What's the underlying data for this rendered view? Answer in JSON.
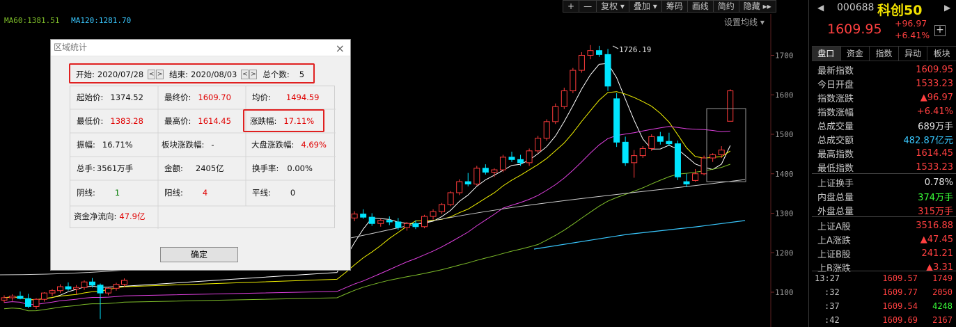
{
  "toolbar": {
    "buttons": [
      "+",
      "—",
      "复权 ▾",
      "叠加 ▾",
      "筹码",
      "画线",
      "简约",
      "隐藏 ▸▸"
    ]
  },
  "ma_legend": {
    "items": [
      {
        "label": "MA60:1381.51",
        "color": "#7fbf2a"
      },
      {
        "label": "MA120:1281.70",
        "color": "#39c8ff"
      }
    ],
    "settings_label": "设置均线 ▾"
  },
  "chart_data": {
    "type": "candlestick",
    "price_axis": {
      "ticks": [
        1700,
        1600,
        1500,
        1400,
        1300,
        1200,
        1100
      ]
    },
    "high_annotation": "1726.19",
    "ohlc": [
      [
        1080,
        1092,
        1074,
        1086
      ],
      [
        1086,
        1095,
        1078,
        1090
      ],
      [
        1090,
        1102,
        1082,
        1084
      ],
      [
        1084,
        1096,
        1060,
        1064
      ],
      [
        1064,
        1085,
        1058,
        1082
      ],
      [
        1082,
        1100,
        1076,
        1098
      ],
      [
        1098,
        1108,
        1090,
        1104
      ],
      [
        1104,
        1120,
        1098,
        1114
      ],
      [
        1114,
        1125,
        1104,
        1108
      ],
      [
        1108,
        1118,
        1095,
        1112
      ],
      [
        1112,
        1130,
        1106,
        1126
      ],
      [
        1126,
        1136,
        1112,
        1118
      ],
      [
        1118,
        1122,
        1032,
        1098
      ],
      [
        1098,
        1112,
        1092,
        1110
      ],
      [
        1110,
        1124,
        1104,
        1120
      ],
      [
        1120,
        1135,
        1114,
        1130
      ],
      [
        1286,
        1296,
        1276,
        1292
      ],
      [
        1292,
        1302,
        1283,
        1288
      ],
      [
        1288,
        1305,
        1280,
        1298
      ],
      [
        1298,
        1310,
        1286,
        1290
      ],
      [
        1290,
        1300,
        1268,
        1274
      ],
      [
        1274,
        1286,
        1266,
        1282
      ],
      [
        1282,
        1292,
        1270,
        1278
      ],
      [
        1278,
        1288,
        1258,
        1264
      ],
      [
        1264,
        1278,
        1256,
        1274
      ],
      [
        1274,
        1282,
        1260,
        1266
      ],
      [
        1266,
        1296,
        1262,
        1292
      ],
      [
        1292,
        1310,
        1284,
        1304
      ],
      [
        1304,
        1326,
        1298,
        1322
      ],
      [
        1322,
        1356,
        1318,
        1352
      ],
      [
        1352,
        1386,
        1346,
        1380
      ],
      [
        1380,
        1402,
        1368,
        1374
      ],
      [
        1374,
        1420,
        1370,
        1414
      ],
      [
        1414,
        1424,
        1398,
        1404
      ],
      [
        1404,
        1414,
        1392,
        1410
      ],
      [
        1410,
        1448,
        1404,
        1442
      ],
      [
        1442,
        1456,
        1430,
        1436
      ],
      [
        1436,
        1448,
        1420,
        1428
      ],
      [
        1428,
        1464,
        1420,
        1458
      ],
      [
        1458,
        1496,
        1452,
        1490
      ],
      [
        1490,
        1538,
        1484,
        1532
      ],
      [
        1532,
        1578,
        1526,
        1570
      ],
      [
        1570,
        1618,
        1564,
        1610
      ],
      [
        1610,
        1668,
        1604,
        1662
      ],
      [
        1662,
        1708,
        1656,
        1700
      ],
      [
        1700,
        1726,
        1690,
        1712
      ],
      [
        1712,
        1724,
        1696,
        1702
      ],
      [
        1702,
        1716,
        1610,
        1622
      ],
      [
        1590,
        1604,
        1468,
        1480
      ],
      [
        1480,
        1494,
        1420,
        1428
      ],
      [
        1428,
        1460,
        1390,
        1446
      ],
      [
        1446,
        1470,
        1440,
        1464
      ],
      [
        1464,
        1500,
        1458,
        1494
      ],
      [
        1494,
        1506,
        1474,
        1482
      ],
      [
        1482,
        1504,
        1470,
        1476
      ],
      [
        1476,
        1484,
        1384,
        1392
      ],
      [
        1380,
        1400,
        1366,
        1374
      ],
      [
        1383,
        1412,
        1380,
        1400
      ],
      [
        1400,
        1446,
        1396,
        1440
      ],
      [
        1440,
        1452,
        1430,
        1448
      ],
      [
        1448,
        1470,
        1440,
        1460
      ],
      [
        1533,
        1614,
        1533,
        1610
      ]
    ],
    "ma_lines": [
      {
        "name": "MA5",
        "color": "#ffffff"
      },
      {
        "name": "MA10",
        "color": "#f0f000"
      },
      {
        "name": "MA20",
        "color": "#e040e0"
      },
      {
        "name": "MA60",
        "color": "#7fbf2a",
        "value": 1381.51
      },
      {
        "name": "MA120",
        "color": "#39c8ff",
        "value": 1281.7
      },
      {
        "name": "MA250",
        "color": "#cfcfcf"
      }
    ],
    "colors": {
      "up": "#ff3b3b",
      "down": "#00e5ff"
    }
  },
  "dialog": {
    "title": "区域统计",
    "close_icon": "×",
    "start_label": "开始:",
    "start_value": "2020/07/28",
    "end_label": "结束:",
    "end_value": "2020/08/03",
    "count_label": "总个数:",
    "count_value": "5",
    "cells": {
      "open": {
        "label": "起始价:",
        "value": "1374.52"
      },
      "close": {
        "label": "最终价:",
        "value": "1609.70"
      },
      "avg": {
        "label": "均价:",
        "value": "1494.59"
      },
      "low": {
        "label": "最低价:",
        "value": "1383.28"
      },
      "high": {
        "label": "最高价:",
        "value": "1614.45"
      },
      "change": {
        "label": "涨跌幅:",
        "value": "17.11%"
      },
      "amplitude": {
        "label": "振幅:",
        "value": "16.71%"
      },
      "sector": {
        "label": "板块涨跌幅:",
        "value": "-"
      },
      "market": {
        "label": "大盘涨跌幅:",
        "value": "4.69%"
      },
      "volume": {
        "label": "总手:",
        "value": "3561万手"
      },
      "amount": {
        "label": "金额:",
        "value": "2405亿"
      },
      "turnover": {
        "label": "换手率:",
        "value": "0.00%"
      },
      "yin": {
        "label": "阴线:",
        "value": "1"
      },
      "yang": {
        "label": "阳线:",
        "value": "4"
      },
      "flat": {
        "label": "平线:",
        "value": "0"
      },
      "netflow": {
        "label": "资金净流向:",
        "value": "47.9亿"
      }
    },
    "ok_label": "确定"
  },
  "right_panel": {
    "code": "000688",
    "name": "科创50",
    "price": "1609.95",
    "change": "+96.97",
    "change_pct": "+6.41%",
    "add_icon": "+",
    "tabs": [
      "盘口",
      "资金",
      "指数",
      "异动",
      "板块"
    ],
    "rows": [
      {
        "label": "最新指数",
        "value": "1609.95",
        "color": "#ff4040"
      },
      {
        "label": "今日开盘",
        "value": "1533.23",
        "color": "#ff4040"
      },
      {
        "label": "指数涨跌",
        "value": "▲96.97",
        "color": "#ff4040"
      },
      {
        "label": "指数涨幅",
        "value": "+6.41%",
        "color": "#ff4040"
      },
      {
        "label": "总成交量",
        "value": "689万手",
        "color": "#e6e6e6"
      },
      {
        "label": "总成交额",
        "value": "482.87亿元",
        "color": "#39c8ff"
      },
      {
        "label": "最高指数",
        "value": "1614.45",
        "color": "#ff4040"
      },
      {
        "label": "最低指数",
        "value": "1533.23",
        "color": "#ff4040"
      },
      {
        "label": "上证换手",
        "value": "0.78%",
        "color": "#e6e6e6"
      },
      {
        "label": "内盘总量",
        "value": "374万手",
        "color": "#39ff39"
      },
      {
        "label": "外盘总量",
        "value": "315万手",
        "color": "#ff4040"
      },
      {
        "label": "上证A股",
        "value": "3516.88",
        "color": "#ff4040"
      },
      {
        "label": "上A涨跌",
        "value": "▲47.45",
        "color": "#ff4040"
      },
      {
        "label": "上证B股",
        "value": "241.21",
        "color": "#ff4040"
      },
      {
        "label": "上B涨跌",
        "value": "▲3.31",
        "color": "#ff4040"
      }
    ],
    "ticks": [
      {
        "time": "13:27",
        "price": "1609.57",
        "vol": "1749",
        "vcolor": "#ff4040"
      },
      {
        "time": ":32",
        "price": "1609.77",
        "vol": "2050",
        "vcolor": "#ff4040"
      },
      {
        "time": ":37",
        "price": "1609.54",
        "vol": "4248",
        "vcolor": "#39ff39"
      },
      {
        "time": ":42",
        "price": "1609.69",
        "vol": "2167",
        "vcolor": "#ff4040"
      }
    ]
  }
}
